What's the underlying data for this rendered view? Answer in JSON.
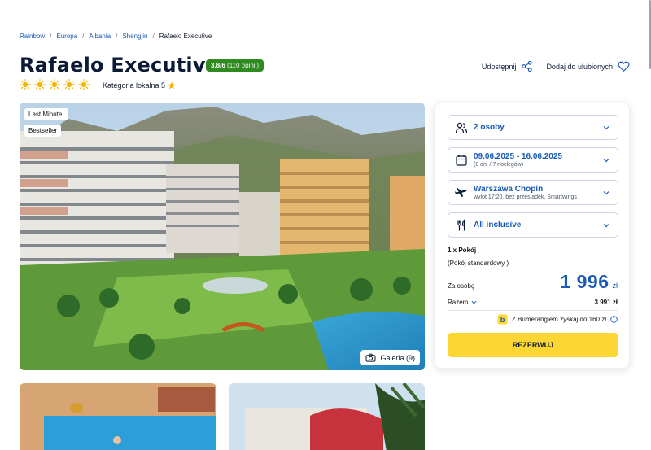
{
  "breadcrumb": {
    "items": [
      "Rainbow",
      "Europa",
      "Albania",
      "Shengjin"
    ],
    "current": "Rafaelo Executive"
  },
  "hotel": {
    "name": "Rafaelo Executive",
    "rating_score": "3.8/6",
    "rating_count": "(110 opinii)",
    "stars": 5,
    "category_label": "Kategoria lokalna 5"
  },
  "actions": {
    "share": "Udostępnij",
    "favorite": "Dodaj do ulubionych"
  },
  "hero": {
    "tags": [
      "Last Minute!",
      "Bestseller"
    ],
    "gallery_label": "Galeria (9)"
  },
  "booking": {
    "persons": "2 osoby",
    "dates": "09.06.2025 - 16.06.2025",
    "dates_sub": "(8 dni / 7 noclegów)",
    "airport": "Warszawa Chopin",
    "airport_sub": "wylot 17:20, bez przesiadek, Smartwings",
    "board": "All inclusive",
    "room_count": "1 x Pokój",
    "room_type": "(Pokój standardowy )",
    "per_person_label": "Za osobę",
    "price": "1 996",
    "currency": "zł",
    "total_label": "Razem",
    "total_value": "3 991 zł",
    "bumerang": "Z Bumerangiem zyskaj do 160 zł",
    "book_button": "REZERWUJ"
  },
  "colors": {
    "accent": "#1a5bb8",
    "book": "#fcd733",
    "rating": "#2f8a1f",
    "star": "#f5b400"
  }
}
